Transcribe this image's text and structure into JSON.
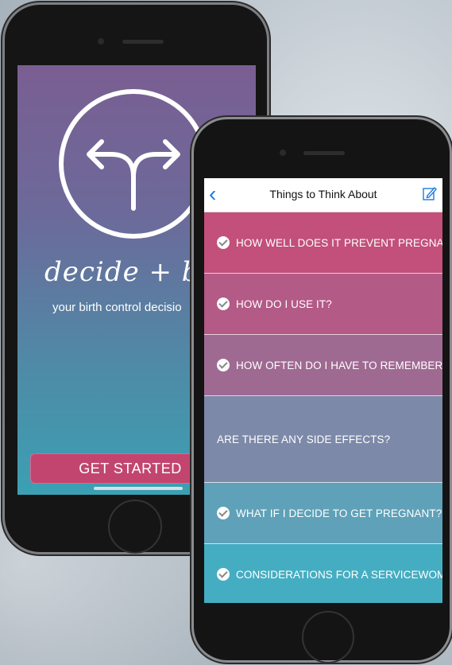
{
  "welcome": {
    "tagline": "decide + be re",
    "subtitle": "your birth control decisio",
    "cta": "GET STARTED"
  },
  "nav": {
    "title": "Things to Think About",
    "back_icon": "chevron-left-icon",
    "edit_icon": "compose-icon"
  },
  "topics": [
    {
      "label": "HOW WELL DOES IT PREVENT PREGNANCY?",
      "checked": true,
      "color": "#c2507a"
    },
    {
      "label": "HOW DO I USE IT?",
      "checked": true,
      "color": "#b35a86"
    },
    {
      "label": "HOW OFTEN DO I HAVE TO REMEMBER IT?",
      "checked": true,
      "color": "#9f6a92"
    },
    {
      "label": "ARE THERE ANY SIDE EFFECTS?",
      "checked": false,
      "color": "#7d89a8"
    },
    {
      "label": "WHAT IF I DECIDE TO GET PREGNANT?",
      "checked": true,
      "color": "#5fa1b8"
    },
    {
      "label": "CONSIDERATIONS FOR A SERVICEWOMAN",
      "checked": true,
      "color": "#45adc2"
    }
  ],
  "colors": {
    "accent": "#c2456f",
    "link": "#1f7ae0"
  }
}
